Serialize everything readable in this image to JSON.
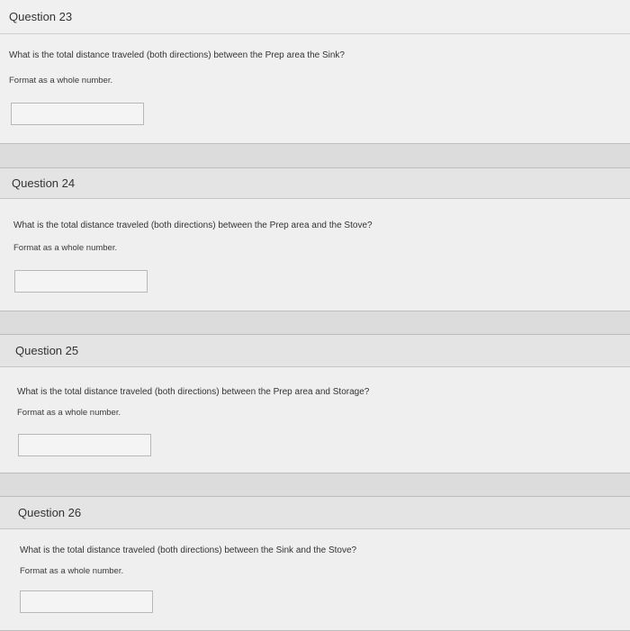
{
  "questions": [
    {
      "title": "Question 23",
      "text": "What is the total distance traveled (both directions) between the Prep area the Sink?",
      "format_hint": "Format as a whole number.",
      "answer_value": ""
    },
    {
      "title": "Question 24",
      "text": "What is the total distance traveled (both directions) between the Prep area and the Stove?",
      "format_hint": "Format as a whole number.",
      "answer_value": ""
    },
    {
      "title": "Question 25",
      "text": "What is the total distance traveled (both directions) between the Prep area and Storage?",
      "format_hint": "Format as a whole number.",
      "answer_value": ""
    },
    {
      "title": "Question 26",
      "text": "What is the total distance traveled (both directions) between the Sink and the Stove?",
      "format_hint": "Format as a whole number.",
      "answer_value": ""
    }
  ]
}
